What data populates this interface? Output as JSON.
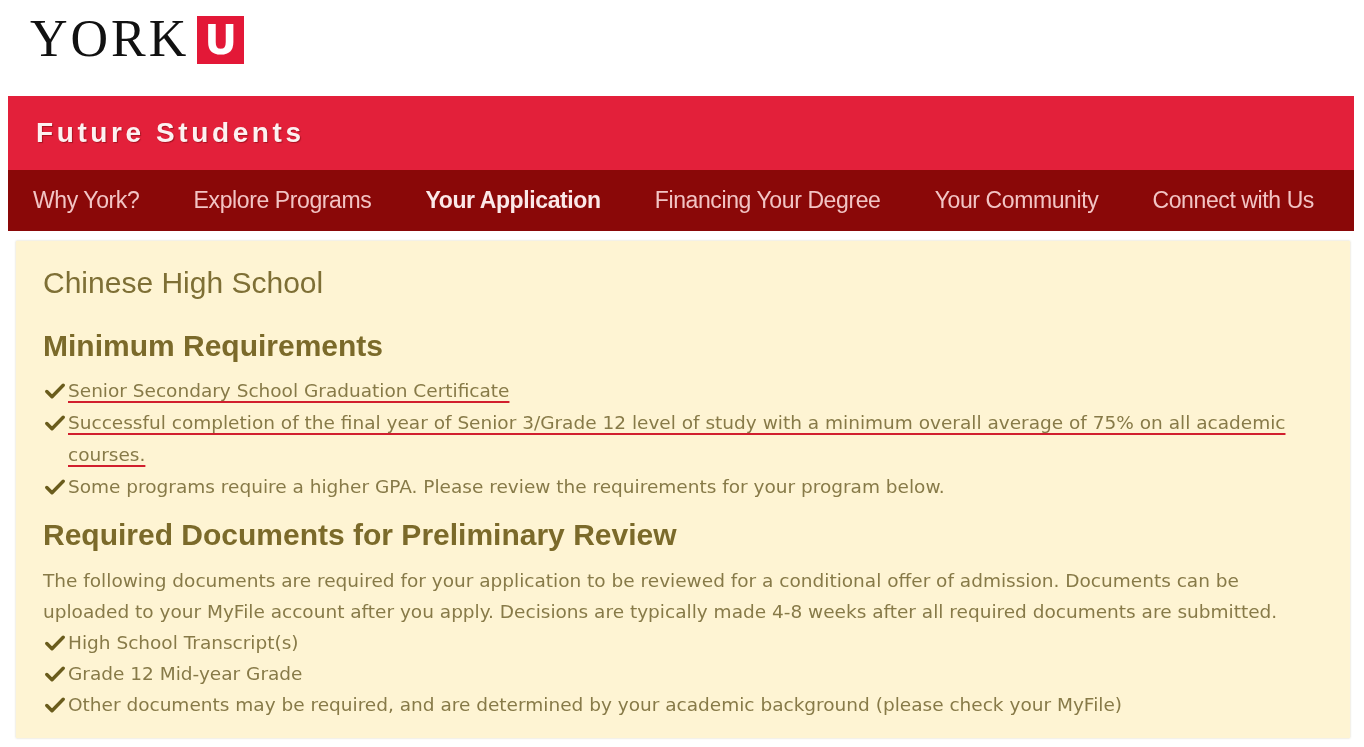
{
  "logo": {
    "wordmark": "YORK",
    "mark": "U"
  },
  "banner": {
    "title": "Future Students"
  },
  "nav": [
    {
      "label": "Why York?",
      "selected": false
    },
    {
      "label": "Explore Programs",
      "selected": false
    },
    {
      "label": "Your Application",
      "selected": true
    },
    {
      "label": "Financing Your Degree",
      "selected": false
    },
    {
      "label": "Your Community",
      "selected": false
    },
    {
      "label": "Connect with Us",
      "selected": false
    }
  ],
  "content": {
    "title": "Chinese High School",
    "sections": [
      {
        "heading": "Minimum Requirements",
        "items": [
          {
            "text": "Senior Secondary School Graduation Certificate",
            "underlined": true
          },
          {
            "text": "Successful completion of the final year of Senior 3/Grade 12 level of study with a minimum overall average of 75% on all academic courses.",
            "underlined": true
          },
          {
            "text": "Some programs require a higher GPA. Please review the requirements for your program below.",
            "underlined": false
          }
        ]
      },
      {
        "heading": "Required Documents for Preliminary Review",
        "intro": "The following documents are required for your application to be reviewed for a conditional offer of admission. Documents can be uploaded to your MyFile account after you apply. Decisions are typically made 4-8 weeks after all required documents are submitted.",
        "items": [
          {
            "text": "High School Transcript(s)",
            "underlined": false
          },
          {
            "text": "Grade 12 Mid-year Grade",
            "underlined": false
          },
          {
            "text": "Other documents may be required, and are determined by your academic background (please check your MyFile)",
            "underlined": false
          }
        ]
      }
    ]
  }
}
